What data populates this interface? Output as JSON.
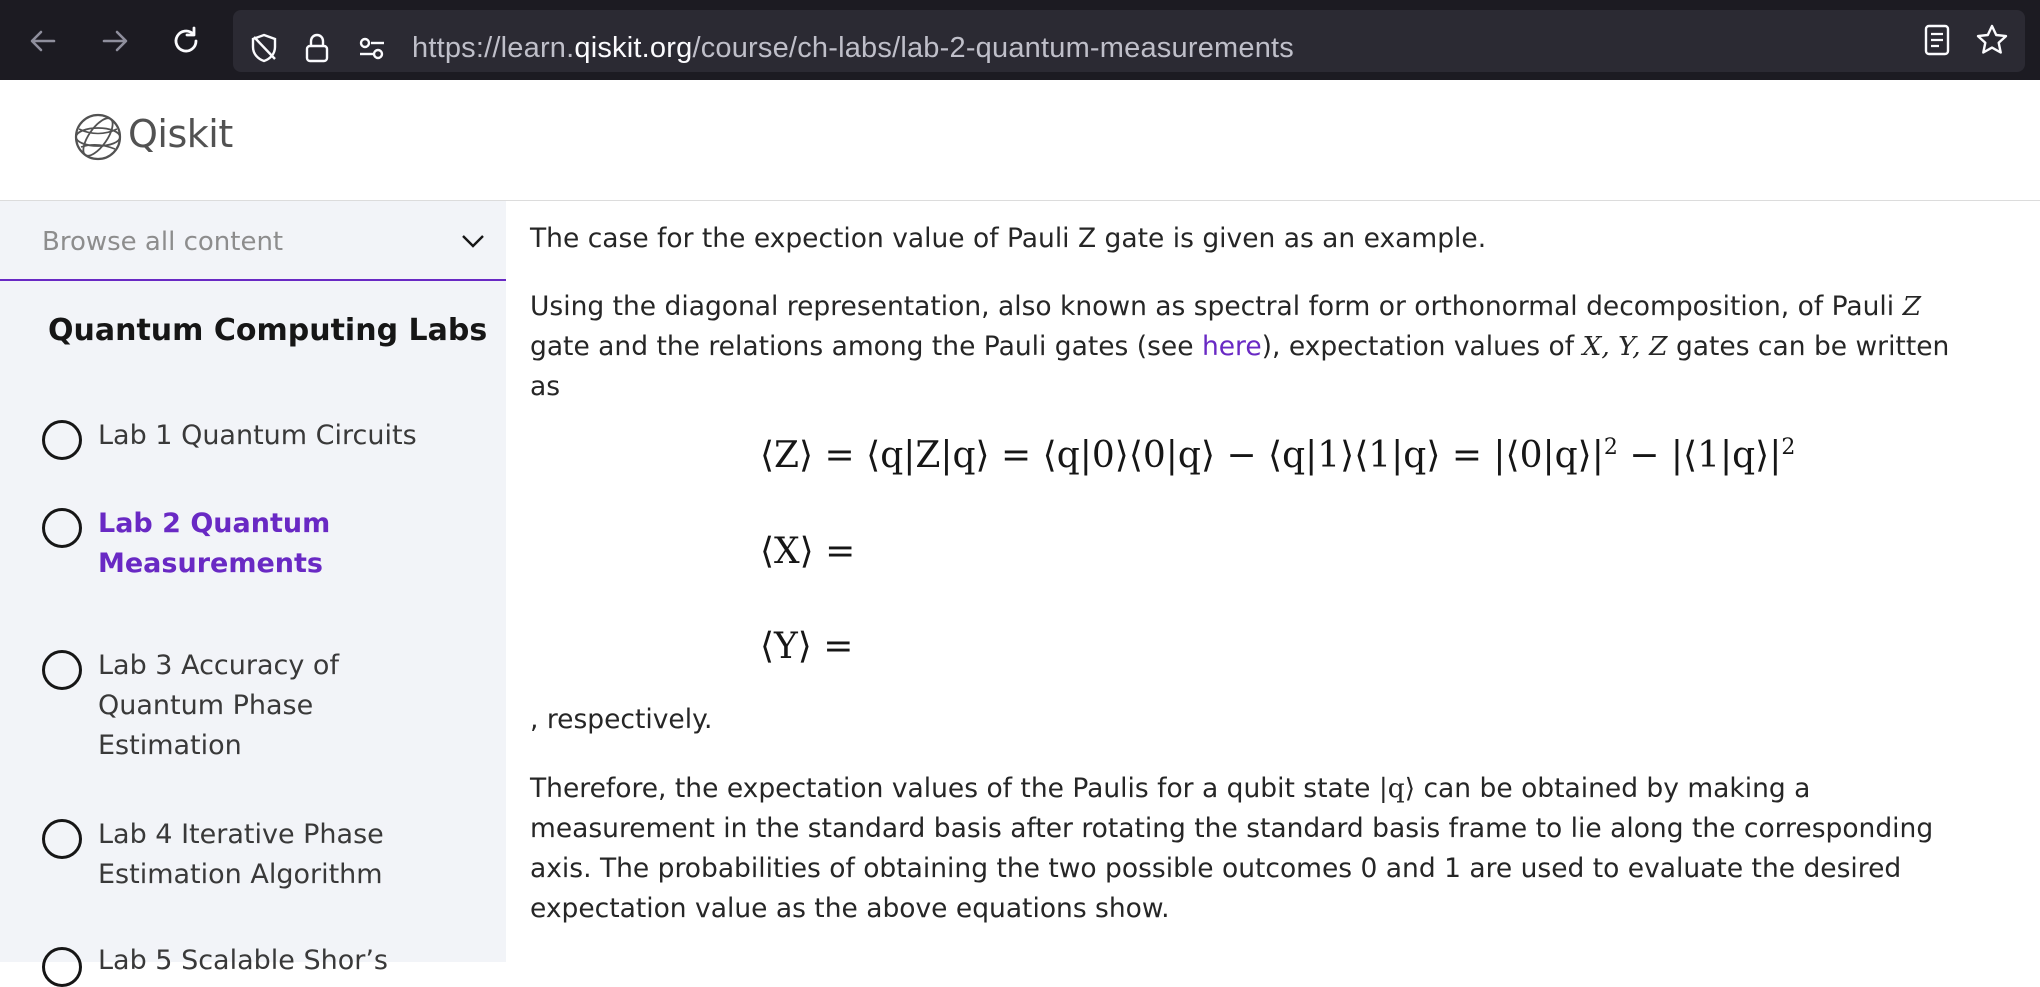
{
  "browser": {
    "url_prefix": "https://learn.",
    "url_host": "qiskit.org",
    "url_path": "/course/ch-labs/lab-2-quantum-measurements"
  },
  "header": {
    "logo_text": "Qiskit"
  },
  "sidebar": {
    "browse_label": "Browse all content",
    "title": "Quantum Computing Labs",
    "items": [
      {
        "label": "Lab 1 Quantum Circuits",
        "active": false
      },
      {
        "label": "Lab 2 Quantum Measurements",
        "active": true
      },
      {
        "label": "Lab 3 Accuracy of Quantum Phase Estimation",
        "active": false
      },
      {
        "label": "Lab 4 Iterative Phase Estimation Algorithm",
        "active": false
      },
      {
        "label": "Lab 5 Scalable Shor’s",
        "active": false
      }
    ]
  },
  "content": {
    "p1": "The case for the expection value of Pauli Z gate is given as an example.",
    "p2_a": "Using the diagonal representation, also known as spectral form or orthonormal decomposition, of Pauli ",
    "p2_z": "Z",
    "p2_b": " gate and the relations among the Pauli gates (see ",
    "p2_link": "here",
    "p2_c": "), expectation values of ",
    "p2_xyz": "X, Y, Z",
    "p2_d": " gates can be written as",
    "eq_z": "⟨Z⟩ = ⟨q|Z|q⟩ = ⟨q|0⟩⟨0|q⟩ − ⟨q|1⟩⟨1|q⟩ = |⟨0|q⟩|",
    "eq_z_tail": " − |⟨1|q⟩|",
    "eq_sup": "2",
    "eq_x": "⟨X⟩ =",
    "eq_y": "⟨Y⟩ =",
    "p3": ", respectively.",
    "p4_a": "Therefore, the expectation values of the Paulis for a qubit state ",
    "p4_ket": "|q⟩",
    "p4_b": " can be obtained by making a measurement in the standard basis after rotating the standard basis frame to lie along the corresponding axis. The probabilities of obtaining the two possible outcomes 0 and 1 are used to evaluate the desired expectation value as the above equations show."
  }
}
